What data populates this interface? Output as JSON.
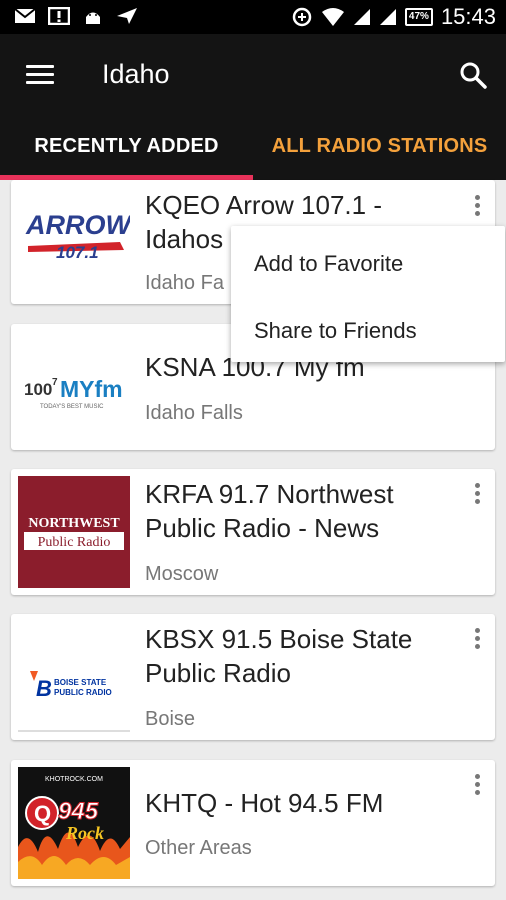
{
  "status_bar": {
    "time": "15:43",
    "battery": "47%",
    "icons": [
      "mail-icon",
      "alert-icon",
      "android-icon",
      "location-arrow-icon",
      "data-saver-icon",
      "wifi-icon",
      "signal-icon",
      "signal-icon",
      "battery-icon"
    ]
  },
  "appbar": {
    "title": "Idaho",
    "tabs": [
      {
        "label": "RECENTLY ADDED",
        "selected": true
      },
      {
        "label": "ALL RADIO STATIONS",
        "selected": false
      }
    ],
    "colors": {
      "background": "#141414",
      "selected_tab": "#ffffff",
      "other_tab": "#f4a13c",
      "indicator": "#e8325a"
    }
  },
  "stations": [
    {
      "name": "KQEO Arrow 107.1 - Idahos",
      "city": "Idaho Fa",
      "logo_text": [
        "ARROW",
        "107.1"
      ]
    },
    {
      "name": "KSNA 100.7 My fm",
      "city": "Idaho Falls",
      "logo_text": [
        "100",
        "7",
        "MYfm",
        "TODAY'S BEST MUSIC"
      ]
    },
    {
      "name": "KRFA 91.7 Northwest Public Radio - News",
      "city": "Moscow",
      "logo_text": [
        "NORTHWEST",
        "Public Radio"
      ]
    },
    {
      "name": "KBSX 91.5 Boise State Public Radio",
      "city": "Boise",
      "logo_text": [
        "BOISE STATE",
        "PUBLIC RADIO"
      ]
    },
    {
      "name": "KHTQ - Hot 94.5 FM",
      "city": "Other Areas",
      "logo_text": [
        "945",
        "Rock",
        "KHOTROCK.COM"
      ]
    }
  ],
  "popup_menu": [
    "Add to Favorite",
    "Share to Friends"
  ]
}
